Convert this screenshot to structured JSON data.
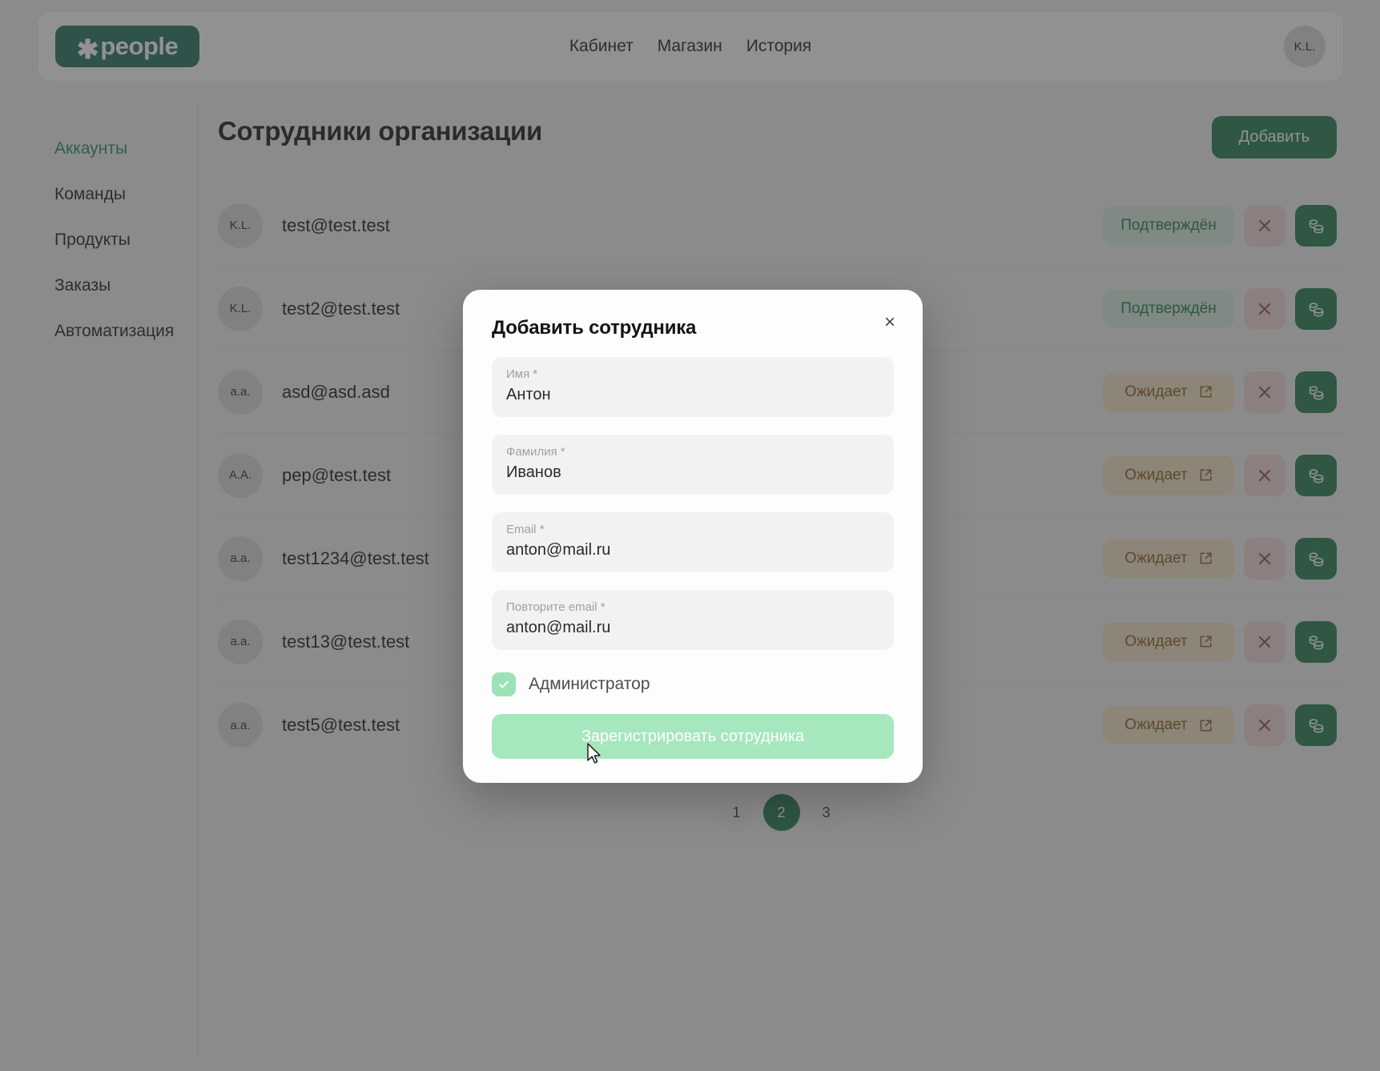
{
  "header": {
    "logo_star": "✱",
    "logo_text": "people",
    "nav": [
      {
        "label": "Кабинет"
      },
      {
        "label": "Магазин"
      },
      {
        "label": "История"
      }
    ],
    "avatar_initials": "K.L."
  },
  "sidebar": {
    "items": [
      {
        "label": "Аккаунты",
        "active": true
      },
      {
        "label": "Команды",
        "active": false
      },
      {
        "label": "Продукты",
        "active": false
      },
      {
        "label": "Заказы",
        "active": false
      },
      {
        "label": "Автоматизация",
        "active": false
      }
    ]
  },
  "main": {
    "title": "Сотрудники организации",
    "add_button": "Добавить",
    "rows": [
      {
        "initials": "K.L.",
        "email": "test@test.test",
        "status": "Подтверждён",
        "status_kind": "ok"
      },
      {
        "initials": "K.L.",
        "email": "test2@test.test",
        "status": "Подтверждён",
        "status_kind": "ok"
      },
      {
        "initials": "a.a.",
        "email": "asd@asd.asd",
        "status": "Ожидает",
        "status_kind": "wait"
      },
      {
        "initials": "A.A.",
        "email": "pep@test.test",
        "status": "Ожидает",
        "status_kind": "wait"
      },
      {
        "initials": "a.a.",
        "email": "test1234@test.test",
        "status": "Ожидает",
        "status_kind": "wait"
      },
      {
        "initials": "a.a.",
        "email": "test13@test.test",
        "status": "Ожидает",
        "status_kind": "wait"
      },
      {
        "initials": "a.a.",
        "email": "test5@test.test",
        "status": "Ожидает",
        "status_kind": "wait"
      }
    ],
    "pagination": [
      {
        "label": "1",
        "current": false
      },
      {
        "label": "2",
        "current": true
      },
      {
        "label": "3",
        "current": false
      }
    ],
    "icons": {
      "delete": "close-icon",
      "pay": "coins-icon",
      "external": "external-link-icon"
    }
  },
  "modal": {
    "title": "Добавить сотрудника",
    "close_label": "×",
    "fields": [
      {
        "label": "Имя",
        "required": "*",
        "value": "Антон",
        "placeholder": "Имя"
      },
      {
        "label": "Фамилия",
        "required": "*",
        "value": "Иванов",
        "placeholder": "Фамилия"
      },
      {
        "label": "Email",
        "required": "*",
        "value": "anton@mail.ru",
        "placeholder": "Email"
      },
      {
        "label": "Повторите email",
        "required": "*",
        "value": "anton@mail.ru",
        "placeholder": "Повторите email"
      }
    ],
    "checkbox": {
      "label": "Администратор",
      "checked": true
    },
    "submit_label": "Зарегистрировать сотрудника"
  },
  "colors": {
    "brand_green": "#1f7a4d",
    "logo_green": "#1f6e5c",
    "active_teal": "#1f8a72",
    "badge_ok_bg": "#d7ebde",
    "badge_wait_bg": "#f2e2c4",
    "delete_bg": "#efd3d6",
    "submit_disabled": "#a6e7be",
    "overlay": "rgba(60,60,60,0.56)"
  }
}
